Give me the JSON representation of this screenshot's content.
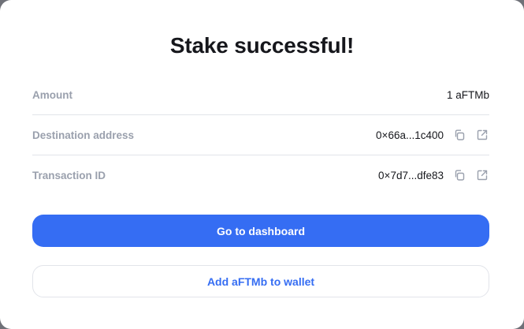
{
  "dialog": {
    "title": "Stake successful!",
    "rows": [
      {
        "label": "Amount",
        "value": "1 aFTMb"
      },
      {
        "label": "Destination address",
        "value": "0×66a...1c400",
        "icons": [
          "copy-icon",
          "external-link-icon"
        ]
      },
      {
        "label": "Transaction ID",
        "value": "0×7d7...dfe83",
        "icons": [
          "copy-icon",
          "external-link-icon"
        ]
      }
    ],
    "primary_button": "Go to dashboard",
    "secondary_button": "Add aFTMb to wallet"
  },
  "colors": {
    "accent": "#356df3",
    "label": "#9aa0ad",
    "text": "#16171c",
    "divider": "#e2e4ea",
    "icon": "#9aa0ad"
  }
}
